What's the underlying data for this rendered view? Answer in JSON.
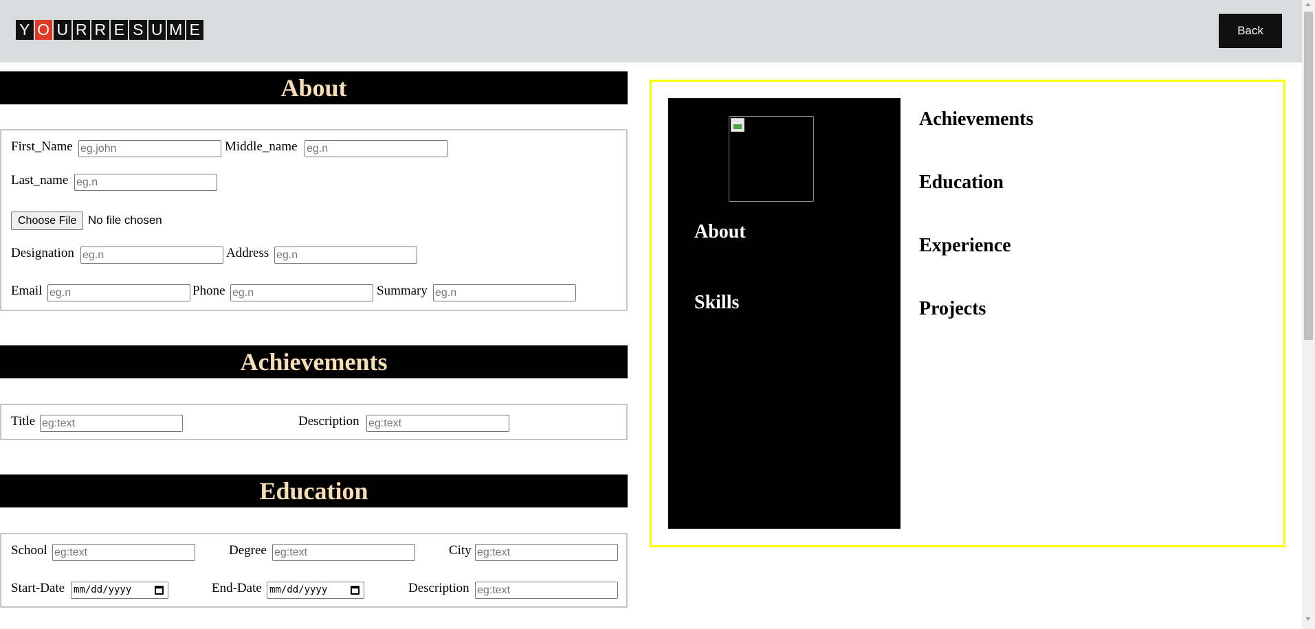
{
  "logo": {
    "letters": [
      "Y",
      "O",
      "U",
      "R",
      "R",
      "E",
      "S",
      "U",
      "M",
      "E"
    ]
  },
  "header": {
    "back_label": "Back"
  },
  "about": {
    "heading": "About",
    "first_name_label": "First_Name",
    "first_name_placeholder": "eg.john",
    "middle_name_label": "Middle_name",
    "middle_name_placeholder": "eg.n",
    "last_name_label": "Last_name",
    "last_name_placeholder": "eg.n",
    "choose_file_label": "Choose File",
    "file_status": "No file chosen",
    "designation_label": "Designation",
    "designation_placeholder": "eg.n",
    "address_label": "Address",
    "address_placeholder": "eg.n",
    "email_label": "Email",
    "email_placeholder": "eg.n",
    "phone_label": "Phone",
    "phone_placeholder": "eg.n",
    "summary_label": "Summary",
    "summary_placeholder": "eg.n"
  },
  "achievements": {
    "heading": "Achievements",
    "title_label": "Title",
    "title_placeholder": "eg:text",
    "description_label": "Description",
    "description_placeholder": "eg:text"
  },
  "education": {
    "heading": "Education",
    "school_label": "School",
    "school_placeholder": "eg:text",
    "degree_label": "Degree",
    "degree_placeholder": "eg:text",
    "city_label": "City",
    "city_placeholder": "eg:text",
    "start_date_label": "Start-Date",
    "start_date_value": "mm/dd/yyyy",
    "end_date_label": "End-Date",
    "end_date_value": "mm/dd/yyyy",
    "description_label": "Description",
    "description_placeholder": "eg:text"
  },
  "preview": {
    "sidebar": [
      "About",
      "Skills"
    ],
    "main": [
      "Achievements",
      "Education",
      "Experience",
      "Projects"
    ]
  }
}
